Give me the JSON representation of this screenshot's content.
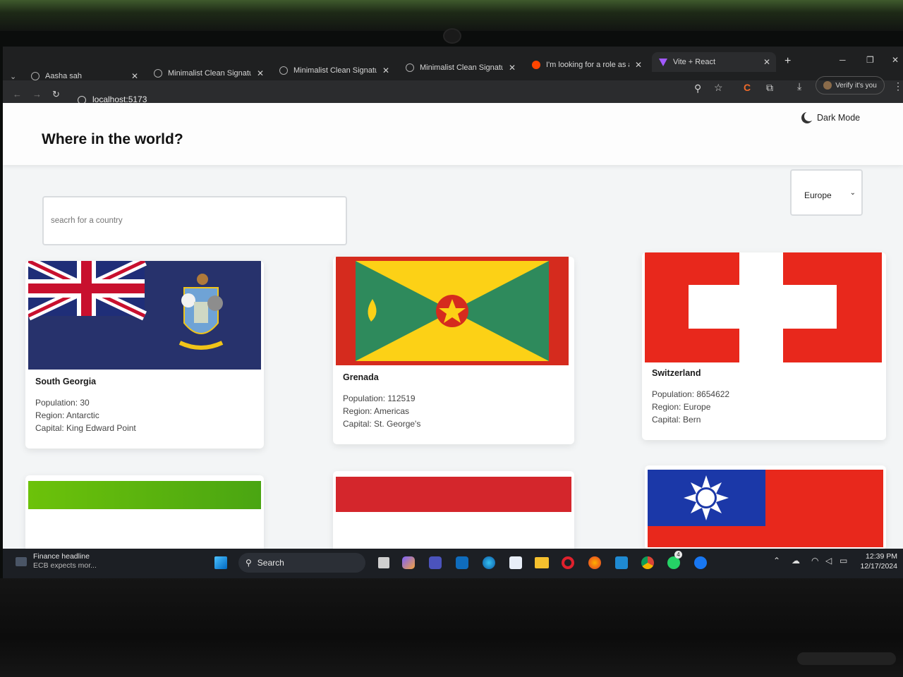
{
  "browser": {
    "tabs": [
      {
        "title": "Aasha sah"
      },
      {
        "title": "Minimalist Clean Signature"
      },
      {
        "title": "Minimalist Clean Signature"
      },
      {
        "title": "Minimalist Clean Signature"
      },
      {
        "title": "I'm looking for a role as a"
      },
      {
        "title": "Vite + React"
      }
    ],
    "url": "localhost:5173",
    "verify_label": "Verify it's you"
  },
  "page": {
    "title": "Where in the world?",
    "dark_mode_label": "Dark Mode",
    "search_placeholder": "seacrh for a country",
    "region_selected": "Europe"
  },
  "countries": [
    {
      "name": "South Georgia",
      "population": "Population: 30",
      "region": "Region: Antarctic",
      "capital": "Capital: King Edward Point"
    },
    {
      "name": "Grenada",
      "population": "Population: 112519",
      "region": "Region: Americas",
      "capital": "Capital: St. George's"
    },
    {
      "name": "Switzerland",
      "population": "Population: 8654622",
      "region": "Region: Europe",
      "capital": "Capital: Bern"
    }
  ],
  "taskbar": {
    "news_title": "Finance headline",
    "news_sub": "ECB expects mor...",
    "search_label": "Search",
    "time": "12:39 PM",
    "date": "12/17/2024",
    "whatsapp_badge": "4"
  },
  "colors": {
    "page_bg": "#f3f5f6",
    "card_bg": "#ffffff",
    "taskbar_bg": "#1c1f24"
  }
}
